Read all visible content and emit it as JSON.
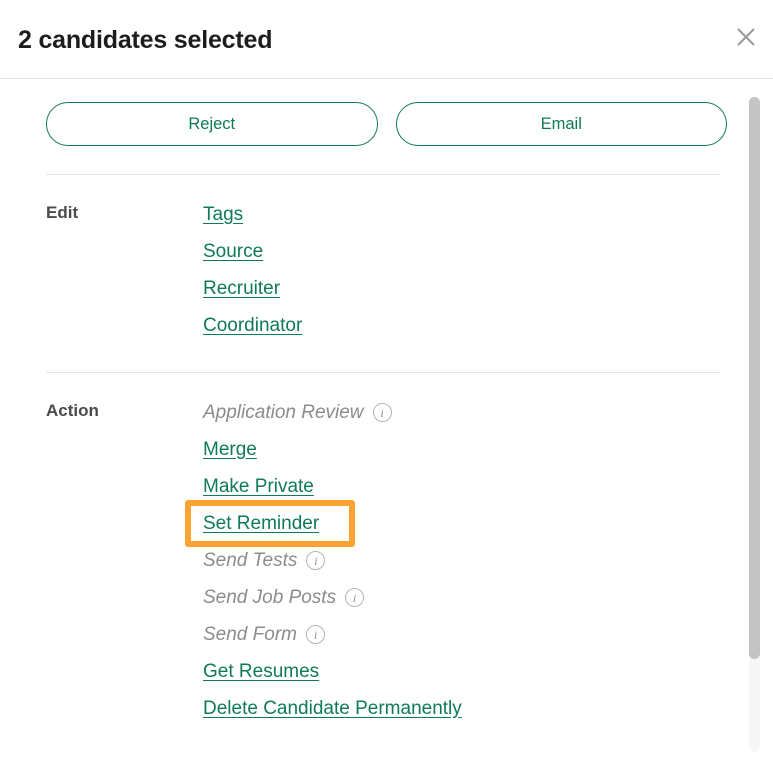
{
  "header": {
    "title": "2 candidates selected",
    "close_icon": "close-icon"
  },
  "buttons": [
    {
      "label": "Reject",
      "name": "reject-button"
    },
    {
      "label": "Email",
      "name": "email-button"
    }
  ],
  "sections": [
    {
      "label": "Edit",
      "items": [
        {
          "label": "Tags",
          "enabled": true
        },
        {
          "label": "Source",
          "enabled": true
        },
        {
          "label": "Recruiter",
          "enabled": true
        },
        {
          "label": "Coordinator",
          "enabled": true
        }
      ]
    },
    {
      "label": "Action",
      "items": [
        {
          "label": "Application Review",
          "enabled": false,
          "info": "i"
        },
        {
          "label": "Merge",
          "enabled": true
        },
        {
          "label": "Make Private",
          "enabled": true
        },
        {
          "label": "Set Reminder",
          "enabled": true,
          "highlighted": true
        },
        {
          "label": "Send Tests",
          "enabled": false,
          "info": "i"
        },
        {
          "label": "Send Job Posts",
          "enabled": false,
          "info": "i"
        },
        {
          "label": "Send Form",
          "enabled": false,
          "info": "i"
        },
        {
          "label": "Get Resumes",
          "enabled": true
        },
        {
          "label": "Delete Candidate Permanently",
          "enabled": true
        }
      ]
    }
  ],
  "colors": {
    "link_green": "#0f7a57",
    "highlight_orange": "#fca332",
    "disabled_gray": "#8c8c8c",
    "label_gray": "#4a4a4a",
    "divider": "#e6e6e6",
    "scrollbar_thumb": "#c4c4c4"
  },
  "scrollbar": {
    "name": "vertical-scrollbar"
  }
}
